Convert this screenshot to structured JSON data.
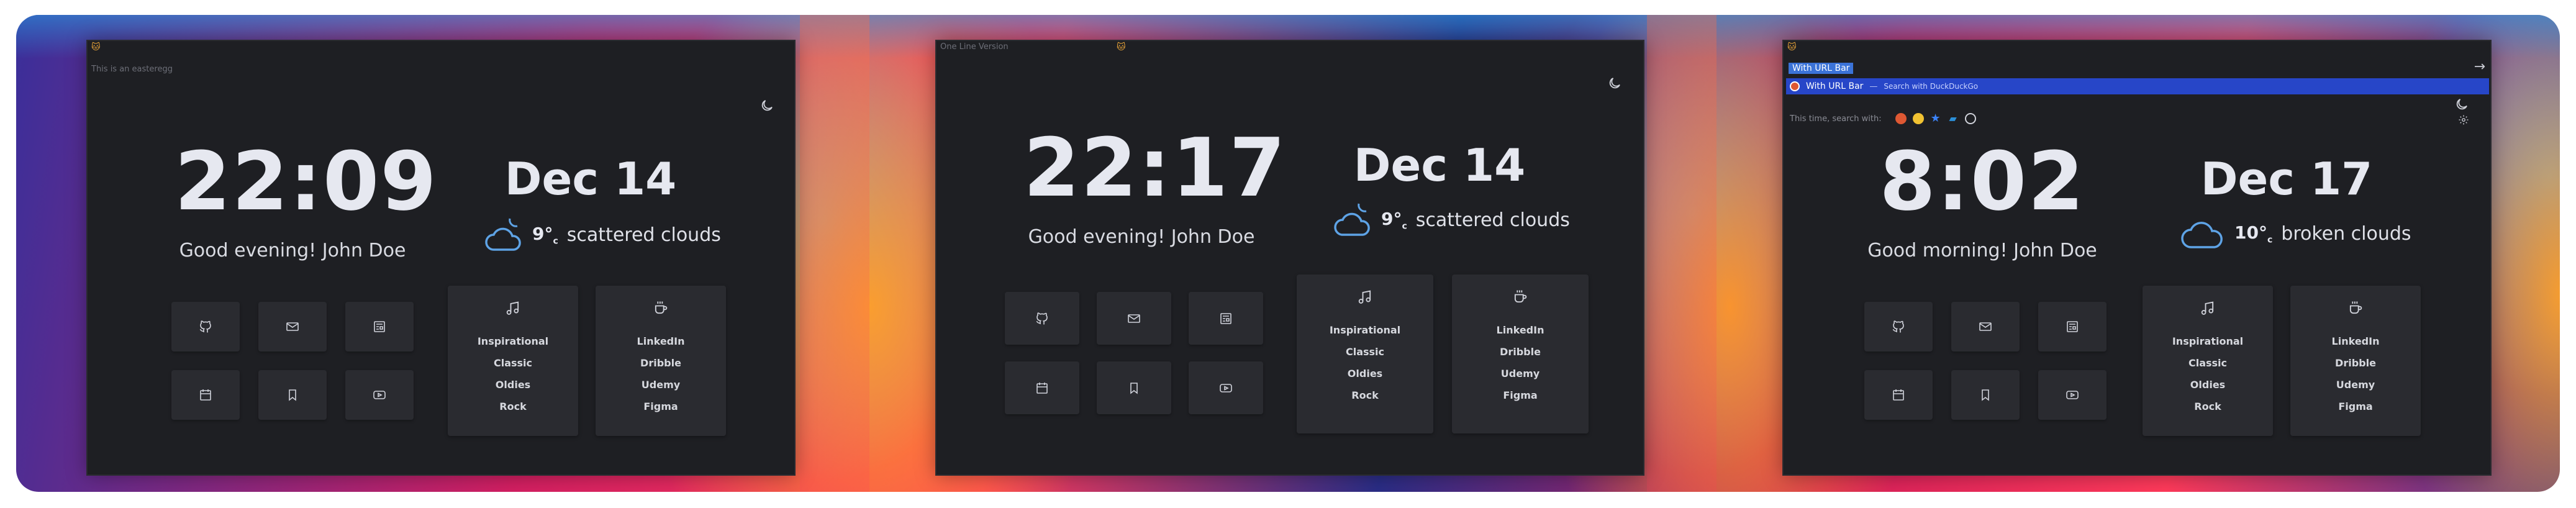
{
  "screens": [
    {
      "placeholder": "This is an easteregg",
      "time": "22:09",
      "greeting": "Good evening! John Doe",
      "date": "Dec 14",
      "temp": "9°",
      "temp_unit": "c",
      "weather": "scattered clouds"
    },
    {
      "placeholder": "One Line Version",
      "time": "22:17",
      "greeting": "Good evening! John Doe",
      "date": "Dec 14",
      "temp": "9°",
      "temp_unit": "c",
      "weather": "scattered clouds"
    },
    {
      "search_value": "With URL Bar",
      "suggestion_query": "With URL Bar",
      "suggestion_separator": "—",
      "suggestion_hint": "Search with DuckDuckGo",
      "engines_label": "This time, search with:",
      "time": "8:02",
      "greeting": "Good morning! John Doe",
      "date": "Dec 17",
      "temp": "10°",
      "temp_unit": "c",
      "weather": "broken clouds"
    }
  ],
  "shortcuts": [
    "github-icon",
    "mail-icon",
    "news-icon",
    "calendar-icon",
    "bookmark-icon",
    "youtube-icon"
  ],
  "music_card": {
    "icon": "music-note-icon",
    "items": [
      "Inspirational",
      "Classic",
      "Oldies",
      "Rock"
    ]
  },
  "links_card": {
    "icon": "coffee-cup-icon",
    "items": [
      "LinkedIn",
      "Dribble",
      "Udemy",
      "Figma"
    ]
  },
  "engine_icons": [
    "duckduckgo-icon",
    "google-icon",
    "star-icon",
    "bookmark-icon",
    "history-icon"
  ],
  "colors": {
    "panel_bg": "#1e1f23",
    "tile_bg": "#2a2b30",
    "accent_blue": "#5ea3e6",
    "cat_orange": "#f0a93a",
    "suggestion_bg": "#2746c8"
  }
}
